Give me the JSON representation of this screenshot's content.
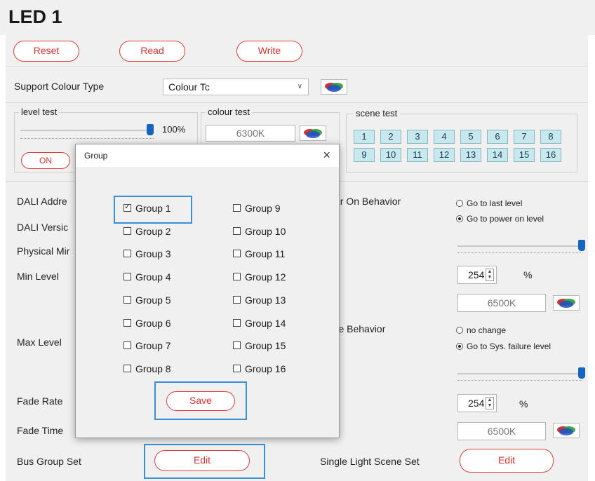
{
  "window": {
    "title": "LED 1"
  },
  "toolbar": {
    "reset": "Reset",
    "read": "Read",
    "write": "Write"
  },
  "colour_type": {
    "label": "Support Colour Type",
    "value": "Colour Tc"
  },
  "level_test": {
    "title": "level test",
    "percent": "100%",
    "level_fraction": 1.0,
    "on_button": "ON"
  },
  "colour_test": {
    "title": "colour test",
    "value": "6300K"
  },
  "scene_test": {
    "title": "scene test",
    "buttons": [
      "1",
      "2",
      "3",
      "4",
      "5",
      "6",
      "7",
      "8",
      "9",
      "10",
      "11",
      "12",
      "13",
      "14",
      "15",
      "16"
    ]
  },
  "left_labels": {
    "dali_address": "DALI Addre",
    "dali_version": "DALI Versic",
    "physical_min": "Physical Mir",
    "min_level": "Min Level",
    "max_level": "Max Level",
    "fade_rate": "Fade Rate",
    "fade_time": "Fade Time",
    "bus_group_set": "Bus Group Set"
  },
  "bus_group": {
    "edit": "Edit"
  },
  "power_on": {
    "label": "ver On Behavior",
    "options": [
      "Go to last level",
      "Go to power on level"
    ],
    "selected_index": 1,
    "slider_fraction": 1.0,
    "level": "254",
    "unit": "%",
    "colour": "6500K"
  },
  "failure": {
    "label": "ure Behavior",
    "options": [
      "no change",
      "Go to Sys. failure level"
    ],
    "selected_index": 1,
    "slider_fraction": 1.0,
    "level": "254",
    "unit": "%",
    "colour": "6500K"
  },
  "single_scene": {
    "label": "Single Light Scene Set",
    "edit": "Edit"
  },
  "dialog": {
    "title": "Group",
    "close": "×",
    "groups_left": [
      {
        "label": "Group 1",
        "checked": true
      },
      {
        "label": "Group 2",
        "checked": false
      },
      {
        "label": "Group 3",
        "checked": false
      },
      {
        "label": "Group 4",
        "checked": false
      },
      {
        "label": "Group 5",
        "checked": false
      },
      {
        "label": "Group 6",
        "checked": false
      },
      {
        "label": "Group 7",
        "checked": false
      },
      {
        "label": "Group 8",
        "checked": false
      }
    ],
    "groups_right": [
      {
        "label": "Group 9",
        "checked": false
      },
      {
        "label": "Group 10",
        "checked": false
      },
      {
        "label": "Group 11",
        "checked": false
      },
      {
        "label": "Group 12",
        "checked": false
      },
      {
        "label": "Group 13",
        "checked": false
      },
      {
        "label": "Group 14",
        "checked": false
      },
      {
        "label": "Group 15",
        "checked": false
      },
      {
        "label": "Group 16",
        "checked": false
      }
    ],
    "save": "Save"
  },
  "icons": {
    "colour_wheel": "colour-picker-icon"
  },
  "colors": {
    "accent_red": "#e33d3d",
    "highlight_blue": "#3b8fd6",
    "slider_blue": "#1565c0",
    "scene_bg": "#c7e8ec"
  }
}
